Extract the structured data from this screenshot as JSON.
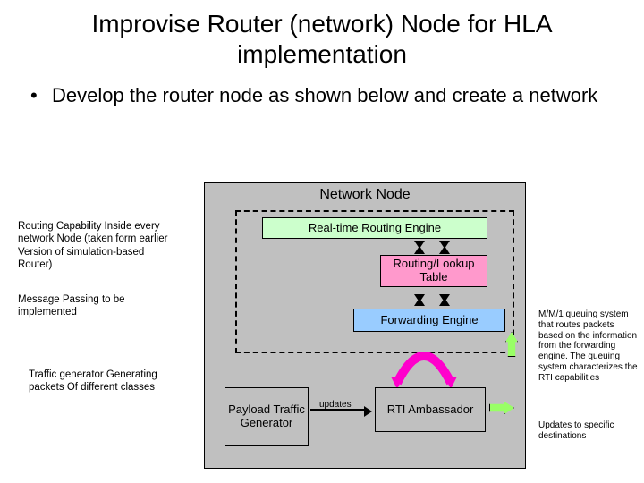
{
  "title": "Improvise Router (network) Node for HLA implementation",
  "bullet": "Develop the router node as shown below and create a network",
  "diagram": {
    "title": "Network Node",
    "rte": "Real-time Routing Engine",
    "rlt": "Routing/Lookup Table",
    "fwd": "Forwarding Engine",
    "ptg": "Payload Traffic Generator",
    "rti": "RTI Ambassador",
    "updates": "updates"
  },
  "notes": {
    "n1": "Routing Capability Inside every network Node (taken form earlier Version of simulation-based Router)",
    "n2": "Message Passing to be implemented",
    "n3": "Traffic generator Generating packets Of different classes",
    "n4": "M/M/1 queuing system that routes packets based on the information from the forwarding engine. The queuing system characterizes the RTI capabilities",
    "n5": "Updates to specific destinations"
  }
}
